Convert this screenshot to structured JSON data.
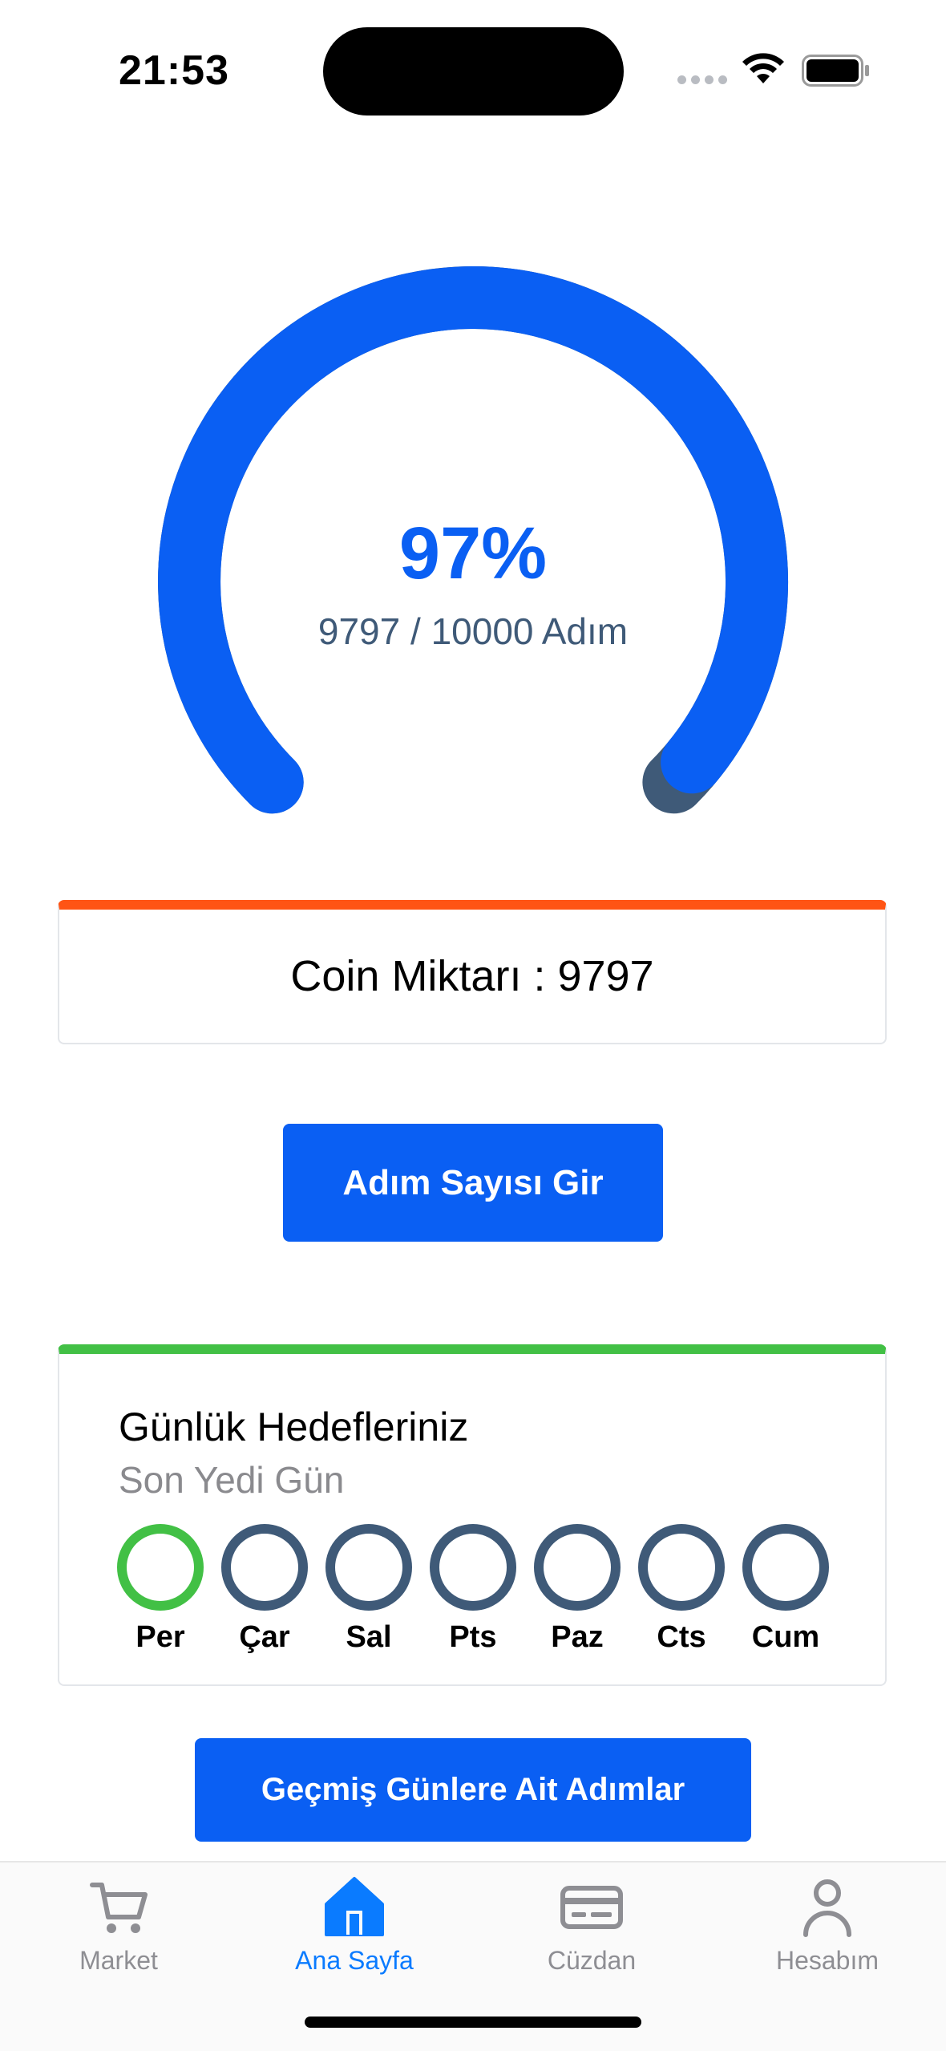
{
  "status_bar": {
    "time": "21:53"
  },
  "gauge": {
    "percent_label": "97%",
    "steps_label": "9797 / 10000 Adım",
    "progress": 0.9797,
    "colors": {
      "progress": "#0a5ff3",
      "track": "#3f5a78"
    }
  },
  "coin": {
    "label": "Coin Miktarı : 9797",
    "accent": "#ff5414"
  },
  "buttons": {
    "enter_steps": "Adım Sayısı Gir",
    "history": "Geçmiş Günlere Ait Adımlar"
  },
  "goals": {
    "title": "Günlük Hedefleriniz",
    "subtitle": "Son Yedi Gün",
    "accent": "#42c045",
    "days": [
      {
        "label": "Per",
        "done": true
      },
      {
        "label": "Çar",
        "done": false
      },
      {
        "label": "Sal",
        "done": false
      },
      {
        "label": "Pts",
        "done": false
      },
      {
        "label": "Paz",
        "done": false
      },
      {
        "label": "Cts",
        "done": false
      },
      {
        "label": "Cum",
        "done": false
      }
    ]
  },
  "tab_bar": {
    "items": [
      {
        "label": "Market",
        "icon": "cart-icon",
        "active": false
      },
      {
        "label": "Ana Sayfa",
        "icon": "home-icon",
        "active": true
      },
      {
        "label": "Cüzdan",
        "icon": "wallet-card-icon",
        "active": false
      },
      {
        "label": "Hesabım",
        "icon": "person-icon",
        "active": false
      }
    ],
    "active_color": "#0a7bff",
    "inactive_color": "#8e8e93"
  }
}
